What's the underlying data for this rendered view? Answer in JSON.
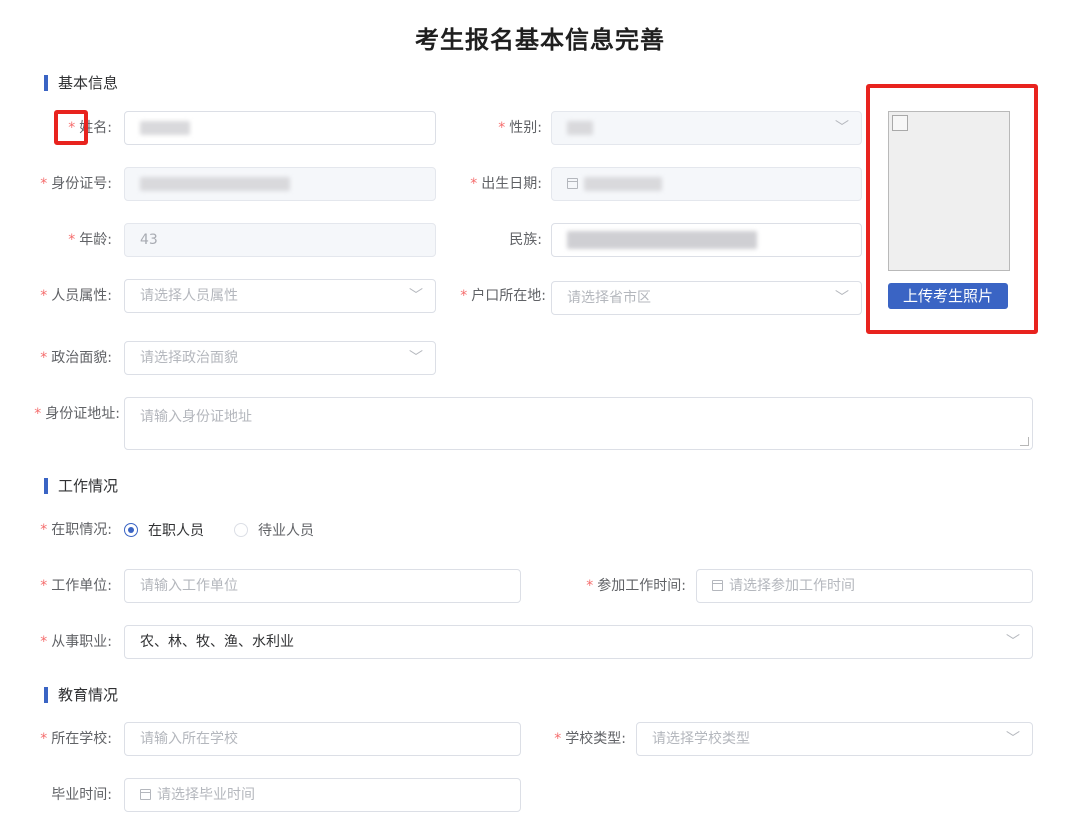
{
  "page": {
    "title": "考生报名基本信息完善"
  },
  "sections": {
    "basic": "基本信息",
    "work": "工作情况",
    "education": "教育情况"
  },
  "required_mark": "*",
  "form": {
    "name": {
      "label": "姓名:"
    },
    "gender": {
      "label": "性别:"
    },
    "id_number": {
      "label": "身份证号:"
    },
    "birth_date": {
      "label": "出生日期:"
    },
    "age": {
      "label": "年龄:",
      "value": "43"
    },
    "ethnicity": {
      "label": "民族:"
    },
    "person_type": {
      "label": "人员属性:",
      "placeholder": "请选择人员属性"
    },
    "household": {
      "label": "户口所在地:",
      "placeholder": "请选择省市区"
    },
    "political": {
      "label": "政治面貌:",
      "placeholder": "请选择政治面貌"
    },
    "id_address": {
      "label": "身份证地址:",
      "placeholder": "请输入身份证地址"
    },
    "employment": {
      "label": "在职情况:",
      "options": [
        "在职人员",
        "待业人员"
      ],
      "selected": "在职人员"
    },
    "work_unit": {
      "label": "工作单位:",
      "placeholder": "请输入工作单位"
    },
    "work_start": {
      "label": "参加工作时间:",
      "placeholder": "请选择参加工作时间"
    },
    "occupation": {
      "label": "从事职业:",
      "value": "农、林、牧、渔、水利业"
    },
    "school": {
      "label": "所在学校:",
      "placeholder": "请输入所在学校"
    },
    "school_type": {
      "label": "学校类型:",
      "placeholder": "请选择学校类型"
    },
    "graduation": {
      "label": "毕业时间:",
      "placeholder": "请选择毕业时间"
    }
  },
  "photo": {
    "upload_label": "上传考生照片"
  },
  "icons": {
    "select": "chevron-down-icon",
    "date": "calendar-icon",
    "photo": "broken-image-icon"
  },
  "colors": {
    "accent": "#3a64c4",
    "required": "#f56c6c",
    "highlight": "#e8231e"
  }
}
